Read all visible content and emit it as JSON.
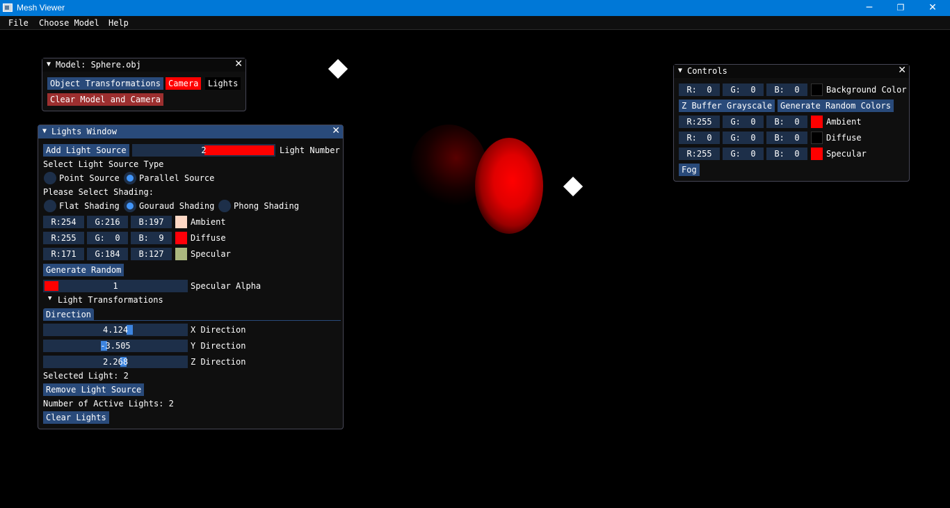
{
  "window": {
    "title": "Mesh Viewer",
    "minimize": "─",
    "maximize": "❐",
    "close": "✕"
  },
  "menu": [
    "File",
    "Choose Model",
    "Help"
  ],
  "model_window": {
    "title": "Model: Sphere.obj",
    "buttons": {
      "object_transformations": "Object Transformations",
      "camera": "Camera",
      "lights": "Lights",
      "clear": "Clear Model and Camera"
    }
  },
  "lights_window": {
    "title": "Lights Window",
    "add_light": "Add Light Source",
    "light_number_value": "2",
    "light_number_label": "Light Number",
    "light_type_heading": "Select Light Source Type",
    "light_types": [
      "Point Source",
      "Parallel Source"
    ],
    "light_type_selected": "Parallel Source",
    "shading_heading": "Please Select Shading:",
    "shading_types": [
      "Flat Shading",
      "Gouraud Shading",
      "Phong Shading"
    ],
    "shading_selected": "Gouraud Shading",
    "colors": [
      {
        "r": "R:254",
        "g": "G:216",
        "b": "B:197",
        "swatch": "#fed8c5",
        "label": "Ambient"
      },
      {
        "r": "R:255",
        "g": "G:  0",
        "b": "B:  9",
        "swatch": "#ff0009",
        "label": "Diffuse"
      },
      {
        "r": "R:171",
        "g": "G:184",
        "b": "B:127",
        "swatch": "#abb87f",
        "label": "Specular"
      }
    ],
    "generate_random": "Generate Random",
    "specular_alpha_value": "1",
    "specular_alpha_label": "Specular Alpha",
    "transformations_header": "Light Transformations",
    "direction_tab": "Direction",
    "directions": [
      {
        "value": "4.124",
        "label": "X Direction"
      },
      {
        "value": "-3.505",
        "label": "Y Direction"
      },
      {
        "value": "2.268",
        "label": "Z Direction"
      }
    ],
    "selected_light": "Selected Light: 2",
    "remove_light": "Remove Light Source",
    "active_lights": "Number of Active Lights: 2",
    "clear_lights": "Clear Lights"
  },
  "controls_window": {
    "title": "Controls",
    "rows": [
      {
        "r": "R:  0",
        "g": "G:  0",
        "b": "B:  0",
        "swatch": "#000000",
        "label": "Background Color"
      },
      {
        "r": "R:255",
        "g": "G:  0",
        "b": "B:  0",
        "swatch": "#ff0000",
        "label": "Ambient"
      },
      {
        "r": "R:  0",
        "g": "G:  0",
        "b": "B:  0",
        "swatch": "#000000",
        "label": "Diffuse"
      },
      {
        "r": "R:255",
        "g": "G:  0",
        "b": "B:  0",
        "swatch": "#ff0000",
        "label": "Specular"
      }
    ],
    "z_buffer": "Z Buffer Grayscale",
    "random_colors": "Generate Random Colors",
    "fog": "Fog"
  },
  "icons": {
    "collapse": "▼",
    "close": "✕",
    "tree": "▼"
  },
  "colors": {
    "accent": "#294a7a",
    "camera_active": "#ff0000",
    "clear_button": "#9c2f2f",
    "slider_fill": "#ff0000"
  }
}
